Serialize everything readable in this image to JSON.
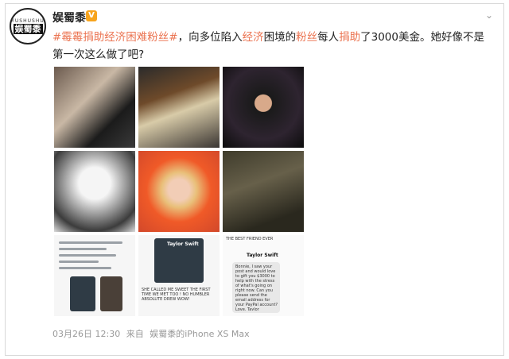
{
  "author": {
    "name": "娱蜀黍",
    "verified_badge": "V",
    "avatar_ring": "YUSHUSHU",
    "avatar_logo": "娱蜀黍"
  },
  "post": {
    "hashtag": "#霉霉捐助经济困难粉丝#",
    "text_1": "，向多位陷入",
    "hl_1": "经济",
    "text_2": "困境的",
    "hl_2": "粉丝",
    "text_3": "每人",
    "hl_3": "捐助",
    "text_4": "了3000美金。她好像不是第一次这么做了吧?"
  },
  "screenshots": {
    "tweet_a": "Taylor Swift",
    "tweet_b": "Taylor Swift",
    "tweet_c": "THE BEST FRIEND EVER",
    "caption_b": "SHE CALLED ME SWEET THE FIRST TIME WE MET TOO ! NO HUMBLER ABSOLUTE DREW WOW!",
    "caption_c": "Bonnie, I saw your post and would love to gift you $3000 to help with the stress of what's going on right now. Can you please send the email address for your PayPal account? Love, Taylor"
  },
  "footer": {
    "date": "03月26日 12:30",
    "via": "来自",
    "source": "娱蜀黍的iPhone XS Max"
  },
  "icons": {
    "more": "chevron-down-icon"
  }
}
